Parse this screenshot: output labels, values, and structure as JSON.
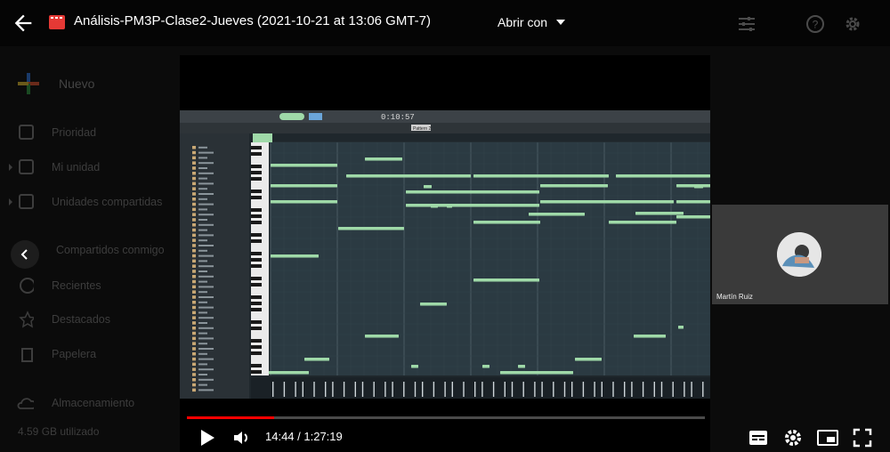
{
  "header": {
    "title": "Análisis-PM3P-Clase2-Jueves (2021-10-21 at 13:06 GMT-7)",
    "open_with": "Abrir con"
  },
  "sidebar": {
    "new_label": "Nuevo",
    "items": [
      {
        "label": "Prioridad"
      },
      {
        "label": "Mi unidad"
      },
      {
        "label": "Unidades compartidas"
      },
      {
        "label": "Compartidos conmigo"
      },
      {
        "label": "Recientes"
      },
      {
        "label": "Destacados"
      },
      {
        "label": "Papelera"
      },
      {
        "label": "Almacenamiento"
      }
    ],
    "storage_used": "4.59 GB utilizado"
  },
  "player": {
    "time": "14:44 / 1:27:19",
    "progress_fraction": 0.168
  },
  "daw": {
    "time_display": "0:10:57",
    "pattern_label": "Pattern 2"
  },
  "camera": {
    "name": "Martín Ruiz"
  },
  "colors": {
    "progress": "#ff0000",
    "note": "#9fd9a8",
    "roll_bg": "#2b3a42"
  }
}
